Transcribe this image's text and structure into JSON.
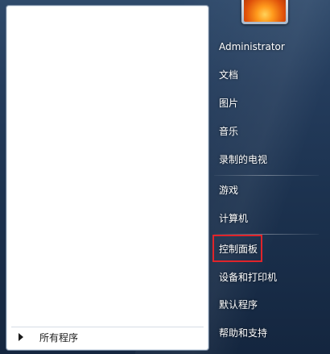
{
  "left_panel": {
    "all_programs_label": "所有程序"
  },
  "right_panel": {
    "user_name": "Administrator",
    "items": [
      {
        "label": "文档"
      },
      {
        "label": "图片"
      },
      {
        "label": "音乐"
      },
      {
        "label": "录制的电视"
      },
      {
        "label": "游戏"
      },
      {
        "label": "计算机"
      },
      {
        "label": "控制面板"
      },
      {
        "label": "设备和打印机"
      },
      {
        "label": "默认程序"
      },
      {
        "label": "帮助和支持"
      }
    ]
  },
  "colors": {
    "highlight_box": "#e0242a",
    "menu_background": "#1c324f"
  }
}
